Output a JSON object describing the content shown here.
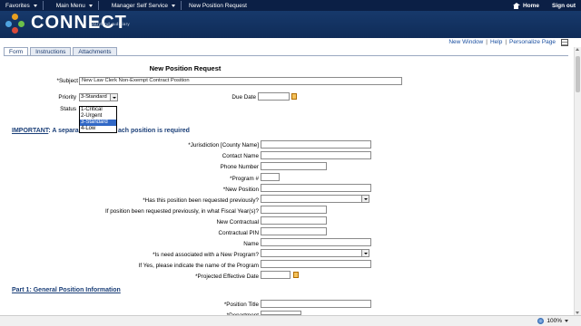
{
  "topnav": {
    "favorites": "Favorites",
    "main_menu": "Main Menu",
    "breadcrumb_1": "Manager Self Service",
    "breadcrumb_2": "New Position Request",
    "home": "Home",
    "sign_out": "Sign out"
  },
  "brand": {
    "name": "CONNECT",
    "subtitle": "Maryland Judiciary"
  },
  "toplinks": {
    "new_window": "New Window",
    "help": "Help",
    "personalize": "Personalize Page"
  },
  "tabs": [
    "Form",
    "Instructions",
    "Attachments"
  ],
  "page": {
    "title": "New Position Request"
  },
  "form": {
    "subject_label": "*Subject",
    "subject_value": "New Law Clerk Non-Exempt Contract Position",
    "priority_label": "Priority",
    "priority_value": "3-Standard",
    "priority_options": [
      "1-Critical",
      "2-Urgent",
      "3-Standard",
      "4-Low"
    ],
    "due_date_label": "Due Date",
    "status_label": "Status",
    "important_prefix": "IMPORTANT",
    "important_text": ": A separa",
    "important_text_tail": "ach position is required",
    "fields": [
      "*Jurisdiction [County Name]",
      "Contact Name",
      "Phone Number",
      "*Program #",
      "*New Position",
      "*Has this position been requested previously?",
      "If position been requested previously, in what Fiscal Year(s)?",
      "New Contractual",
      "Contractual PIN",
      "Name",
      "*Is need associated with a New Program?",
      "If Yes, please indicate the name of the Program",
      "*Projected Effective Date"
    ],
    "part1_heading": "Part 1: General Position Information",
    "position_title_label": "*Position Title",
    "department_label": "*Department"
  },
  "statusbar": {
    "zoom": "100%"
  }
}
